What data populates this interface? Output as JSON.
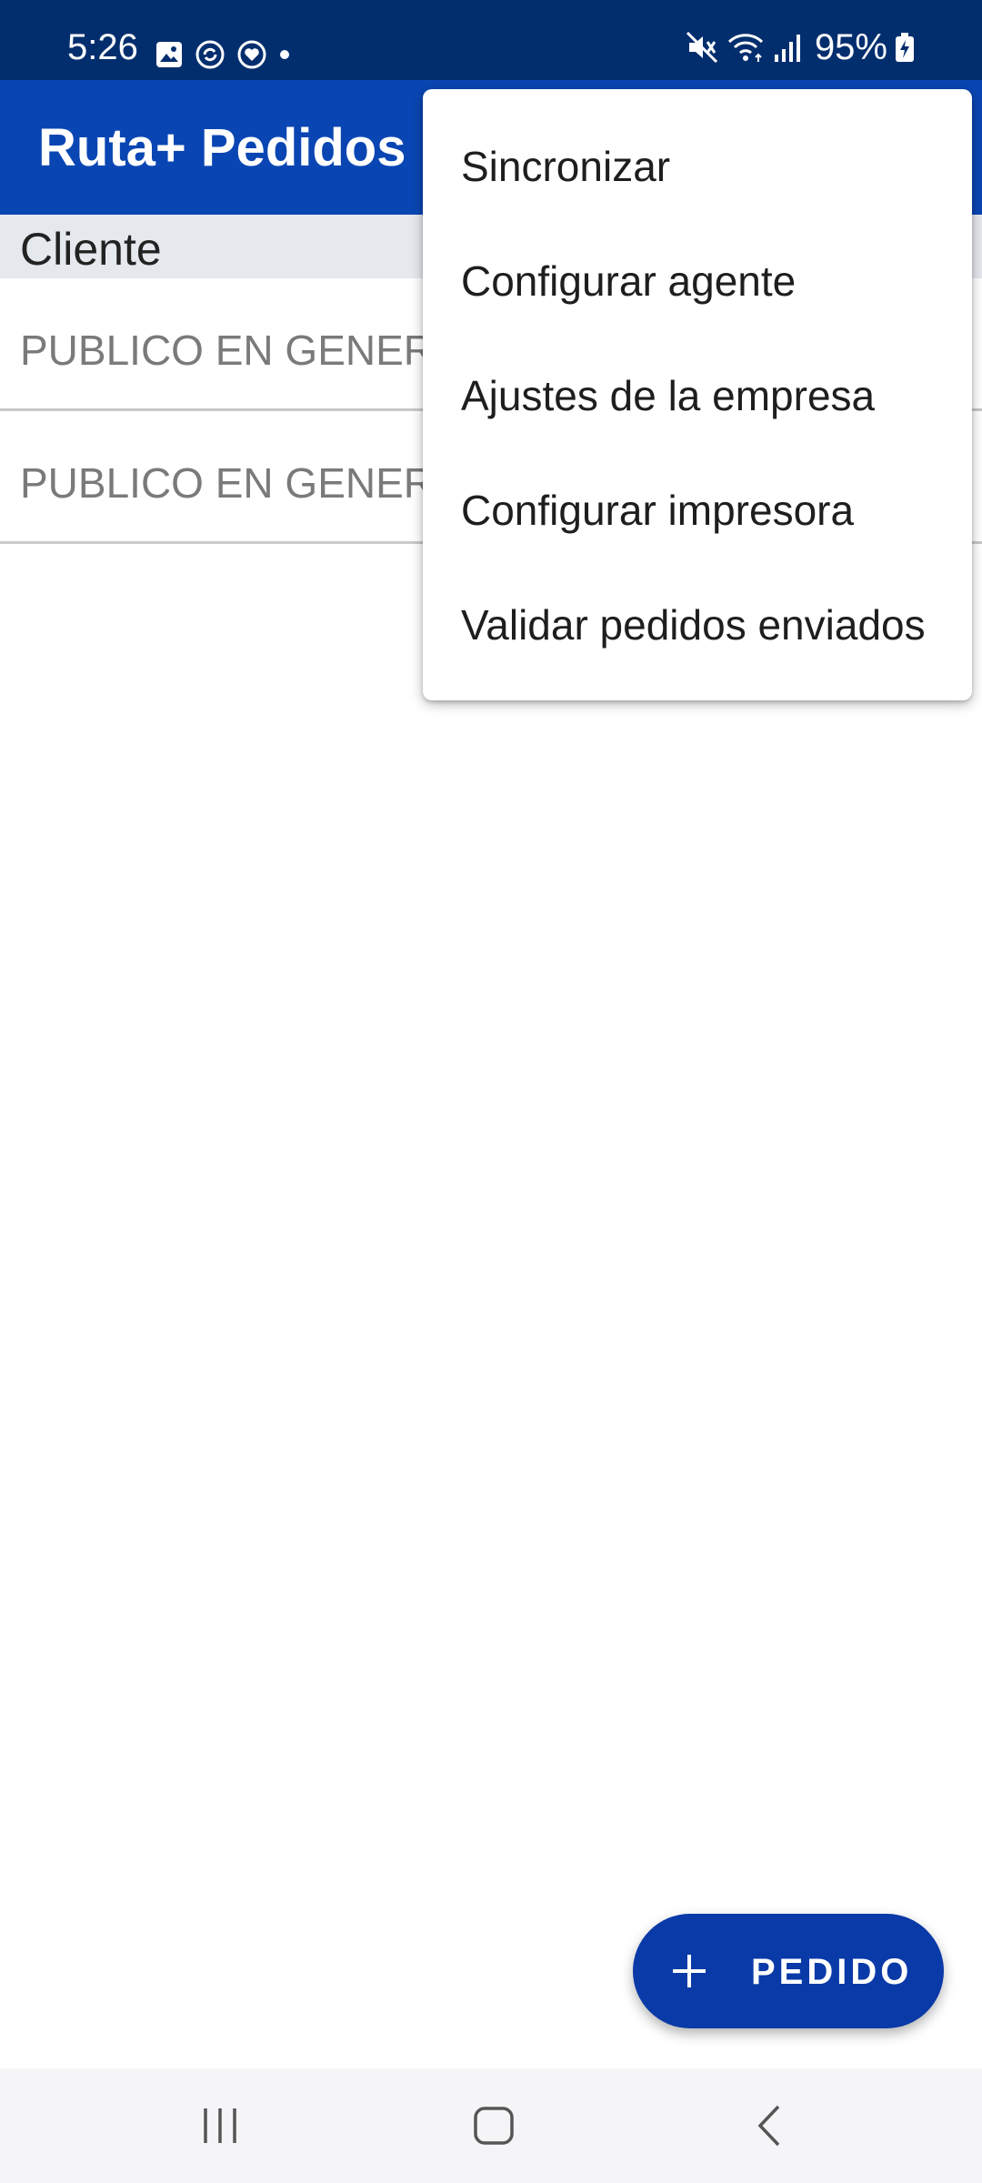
{
  "status_bar": {
    "time": "5:26",
    "battery": "95%",
    "notification_icons": [
      "gallery-icon",
      "sync-icon",
      "health-icon",
      "dot-icon"
    ],
    "system_icons": [
      "mute-icon",
      "wifi-icon",
      "signal-icon",
      "battery-charging-icon"
    ]
  },
  "app_bar": {
    "title": "Ruta+ Pedidos"
  },
  "table": {
    "column_header": "Cliente",
    "rows": [
      {
        "cliente": "PUBLICO EN GENERAL"
      },
      {
        "cliente": "PUBLICO EN GENERAL"
      }
    ]
  },
  "overflow_menu": {
    "items": [
      {
        "label": "Sincronizar"
      },
      {
        "label": "Configurar agente"
      },
      {
        "label": "Ajustes de la empresa"
      },
      {
        "label": "Configurar impresora"
      },
      {
        "label": "Validar pedidos enviados"
      }
    ]
  },
  "fab": {
    "icon": "plus-icon",
    "label": "PEDIDO"
  },
  "nav_bar": {
    "buttons": [
      "recents-icon",
      "home-icon",
      "back-icon"
    ]
  },
  "colors": {
    "status_bar": "#032e6e",
    "app_bar": "#0a46b3",
    "fab": "#0a3aa8",
    "header_bg": "#e5e8ed"
  }
}
